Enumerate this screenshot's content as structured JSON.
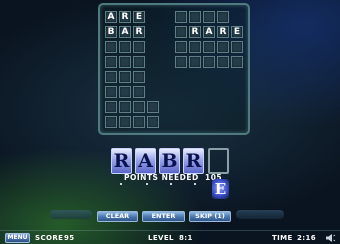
{
  "board": {
    "words": [
      {
        "letters": [
          "A",
          "R",
          "E"
        ]
      },
      {
        "letters": [
          "B",
          "A",
          "R"
        ]
      },
      {
        "letters": [
          "R",
          "A",
          "R",
          "E"
        ]
      }
    ]
  },
  "rack": {
    "tiles": [
      "R",
      "A",
      "B",
      "R",
      ""
    ],
    "pool_tile": "E"
  },
  "points_needed": {
    "label": "POINTS NEEDED",
    "value": "105"
  },
  "buttons": {
    "clear": "CLEAR",
    "enter": "ENTER",
    "skip": "SKIP (1)"
  },
  "status": {
    "menu": "MENU",
    "score_label": "SCORE",
    "score": "95",
    "level_label": "LEVEL",
    "level": "8:1",
    "time_label": "TIME",
    "time": "2:16"
  },
  "colors": {
    "tile": "#8a96e0",
    "button": "#4d7ab0",
    "board_border": "#4e7a80"
  }
}
